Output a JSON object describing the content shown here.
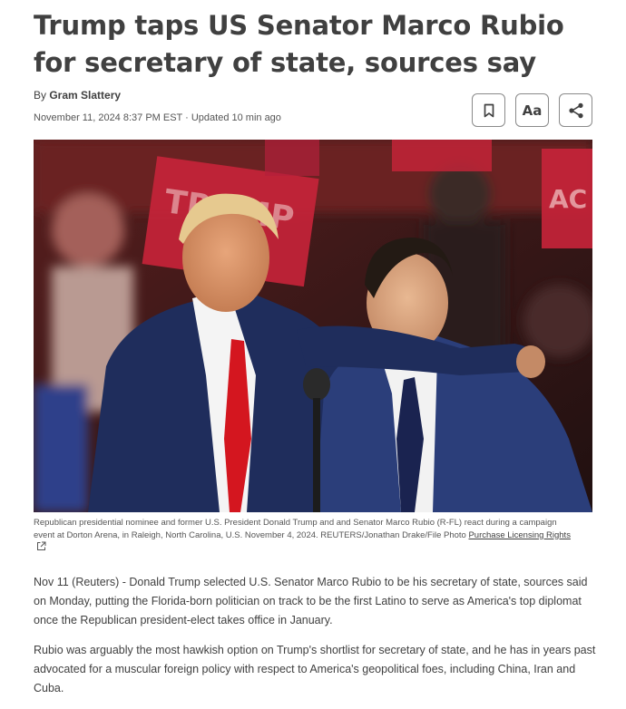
{
  "article": {
    "headline": "Trump taps US Senator Marco Rubio for secretary of state, sources say",
    "byline_prefix": "By ",
    "author": "Gram Slattery",
    "dateline": "November 11, 2024 8:37 PM EST · Updated 10 min ago"
  },
  "toolbar": {
    "bookmark_icon": "bookmark-icon",
    "font_size_label": "Aa",
    "share_icon": "share-icon"
  },
  "photo": {
    "caption": "Republican presidential nominee and former U.S. President Donald Trump and and Senator Marco Rubio (R-FL) react during a campaign event at Dorton Arena, in Raleigh, North Carolina, U.S. November 4, 2024. REUTERS/Jonathan Drake/File Photo ",
    "license_link": "Purchase Licensing Rights",
    "sign_text_left": "TRUMP",
    "sign_text_right": "AC"
  },
  "body": {
    "paragraph_1": "Nov 11 (Reuters) - Donald Trump selected U.S. Senator Marco Rubio to be his secretary of state, sources said on Monday, putting the Florida-born politician on track to be the first Latino to serve as America's top diplomat once the Republican president-elect takes office in January.",
    "paragraph_2": "Rubio was arguably the most hawkish option on Trump's shortlist for secretary of state, and he has in years past advocated for a muscular foreign policy with respect to America's geopolitical foes, including China, Iran and Cuba."
  }
}
